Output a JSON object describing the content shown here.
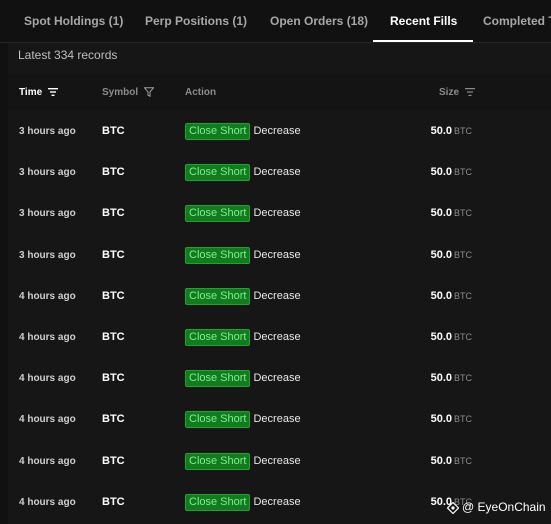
{
  "tabs": [
    {
      "label": "Spot Holdings (1)",
      "active": false
    },
    {
      "label": "Perp Positions (1)",
      "active": false
    },
    {
      "label": "Open Orders (18)",
      "active": false
    },
    {
      "label": "Recent Fills",
      "active": true
    },
    {
      "label": "Completed Tr",
      "active": false
    }
  ],
  "records": "Latest 334 records",
  "columns": {
    "time": "Time",
    "symbol": "Symbol",
    "action": "Action",
    "size": "Size"
  },
  "rows": [
    {
      "time": "3 hours ago",
      "symbol": "BTC",
      "badge": "Close Short",
      "action": "Decrease",
      "size": "50.0",
      "unit": "BTC"
    },
    {
      "time": "3 hours ago",
      "symbol": "BTC",
      "badge": "Close Short",
      "action": "Decrease",
      "size": "50.0",
      "unit": "BTC"
    },
    {
      "time": "3 hours ago",
      "symbol": "BTC",
      "badge": "Close Short",
      "action": "Decrease",
      "size": "50.0",
      "unit": "BTC"
    },
    {
      "time": "3 hours ago",
      "symbol": "BTC",
      "badge": "Close Short",
      "action": "Decrease",
      "size": "50.0",
      "unit": "BTC"
    },
    {
      "time": "4 hours ago",
      "symbol": "BTC",
      "badge": "Close Short",
      "action": "Decrease",
      "size": "50.0",
      "unit": "BTC"
    },
    {
      "time": "4 hours ago",
      "symbol": "BTC",
      "badge": "Close Short",
      "action": "Decrease",
      "size": "50.0",
      "unit": "BTC"
    },
    {
      "time": "4 hours ago",
      "symbol": "BTC",
      "badge": "Close Short",
      "action": "Decrease",
      "size": "50.0",
      "unit": "BTC"
    },
    {
      "time": "4 hours ago",
      "symbol": "BTC",
      "badge": "Close Short",
      "action": "Decrease",
      "size": "50.0",
      "unit": "BTC"
    },
    {
      "time": "4 hours ago",
      "symbol": "BTC",
      "badge": "Close Short",
      "action": "Decrease",
      "size": "50.0",
      "unit": "BTC"
    },
    {
      "time": "4 hours ago",
      "symbol": "BTC",
      "badge": "Close Short",
      "action": "Decrease",
      "size": "50.0",
      "unit": "BTC"
    }
  ],
  "watermark": "@ EyeOnChain",
  "colors": {
    "background": "#111111",
    "badge_bg": "#127a1f",
    "badge_text": "#7cf08a"
  }
}
